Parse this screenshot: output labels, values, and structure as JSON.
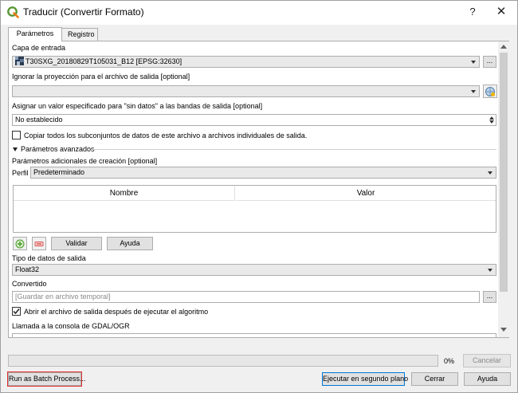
{
  "window": {
    "title": "Traducir (Convertir Formato)",
    "help_symbol": "?",
    "close_symbol": "✕"
  },
  "tabs": [
    {
      "label": "Parámetros"
    },
    {
      "label": "Registro"
    }
  ],
  "params": {
    "input_layer": {
      "label": "Capa de entrada",
      "value": "T30SXG_20180829T105031_B12 [EPSG:32630]",
      "browse": "..."
    },
    "ignore_projection": {
      "label": "Ignorar la proyección para el archivo de salida [optional]",
      "value": ""
    },
    "nodata": {
      "label": "Asignar un valor especificado para \"sin datos\" a las bandas de salida [optional]",
      "value": "No establecido"
    },
    "copy_subdatasets": {
      "label": "Copiar todos los subconjuntos de datos de este archivo a archivos individuales de salida.",
      "checked": false
    },
    "advanced_toggle": "Parámetros avanzados",
    "creation_options": {
      "label": "Parámetros adicionales de creación [optional]",
      "profile_label": "Perfil",
      "profile_value": "Predeterminado"
    },
    "table": {
      "col_name": "Nombre",
      "col_value": "Valor"
    },
    "validate_label": "Validar",
    "help_label": "Ayuda",
    "output_type": {
      "label": "Tipo de datos de salida",
      "value": "Float32"
    },
    "converted": {
      "label": "Convertido",
      "placeholder": "[Guardar en archivo temporal]",
      "browse": "..."
    },
    "open_output": {
      "label": "Abrir el archivo de salida después de ejecutar el algoritmo",
      "checked": true
    },
    "gdal_console": {
      "label": "Llamada a la consola de GDAL/OGR"
    }
  },
  "footer": {
    "progress": {
      "value": 0,
      "label": "0%"
    },
    "cancel": "Cancelar",
    "batch": "Run as Batch Process...",
    "run_background": "Ejecutar en segundo plano",
    "close": "Cerrar",
    "help": "Ayuda"
  },
  "colors": {
    "accent": "#0078d7",
    "batch_outline": "#e03030",
    "add_icon": "#4c9a2a",
    "remove_icon": "#d9534f"
  }
}
